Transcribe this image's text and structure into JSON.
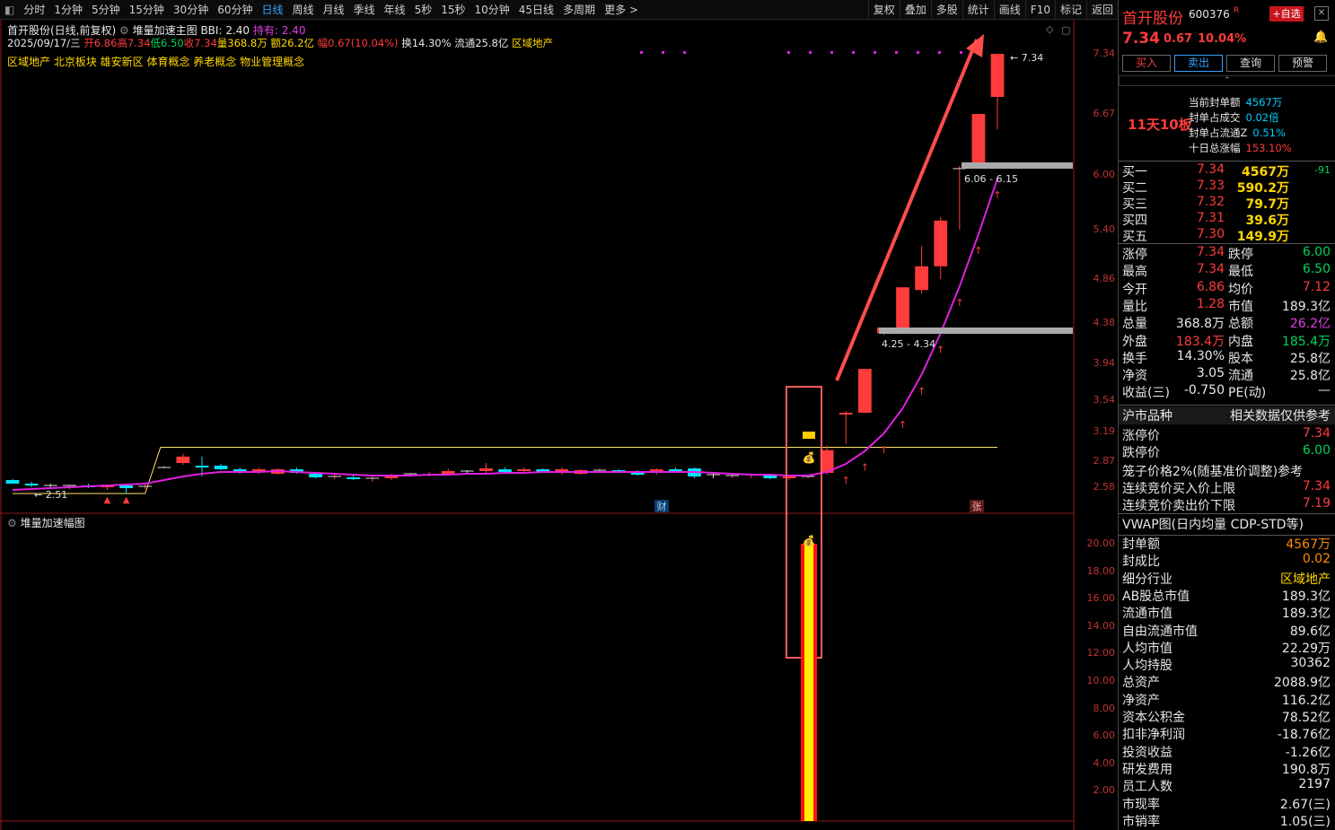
{
  "tabs": [
    "分时",
    "1分钟",
    "5分钟",
    "15分钟",
    "30分钟",
    "60分钟",
    "日线",
    "周线",
    "月线",
    "季线",
    "年线",
    "5秒",
    "15秒",
    "10分钟",
    "45日线",
    "多周期",
    "更多 >"
  ],
  "active_tab": "日线",
  "tools": [
    "复权",
    "叠加",
    "多股",
    "统计",
    "画线",
    "F10",
    "标记",
    "返回"
  ],
  "header": {
    "name_line": "首开股份(日线,前复权)",
    "indicator_name": "堆量加速主图",
    "bbi": "BBI: 2.40",
    "hold": "持有: 2.40"
  },
  "ohlc": {
    "date": "2025/09/17/三",
    "open": "开6.86",
    "high": "高7.34",
    "low": "低6.50",
    "close": "收7.34",
    "vol": "量368.8万",
    "amt": "额26.2亿",
    "chg": "幅0.67(10.04%)",
    "turnover": "换14.30%",
    "float": "流通25.8亿",
    "sector": "区域地产"
  },
  "concepts": "区域地产 北京板块 雄安新区 体育概念 养老概念 物业管理概念",
  "price_axis": [
    "7.34",
    "6.67",
    "6.00",
    "5.40",
    "4.86",
    "4.38",
    "3.94",
    "3.54",
    "3.19",
    "2.87",
    "2.58"
  ],
  "sub_axis": [
    "20.00",
    "18.00",
    "16.00",
    "14.00",
    "12.00",
    "10.00",
    "8.00",
    "6.00",
    "4.00",
    "2.00"
  ],
  "sub_title": "堆量加速幅图",
  "annotations": {
    "high": "7.34",
    "low": "2.51",
    "zone1": "6.06 - 6.15",
    "zone2": "4.25 - 4.34",
    "cai": "财",
    "zhang": "张"
  },
  "chart_data": {
    "type": "candlestick",
    "series": [
      {
        "name": "K线",
        "ohlc": [
          [
            2.66,
            2.67,
            2.62,
            2.62
          ],
          [
            2.62,
            2.64,
            2.58,
            2.6
          ],
          [
            2.6,
            2.62,
            2.58,
            2.59
          ],
          [
            2.59,
            2.61,
            2.56,
            2.6
          ],
          [
            2.6,
            2.62,
            2.57,
            2.58
          ],
          [
            2.58,
            2.61,
            2.55,
            2.6
          ],
          [
            2.6,
            2.62,
            2.51,
            2.57
          ],
          [
            2.58,
            2.63,
            2.56,
            2.59
          ],
          [
            2.8,
            2.82,
            2.79,
            2.8
          ],
          [
            2.85,
            2.95,
            2.83,
            2.92
          ],
          [
            2.82,
            2.92,
            2.7,
            2.8
          ],
          [
            2.82,
            2.84,
            2.77,
            2.78
          ],
          [
            2.78,
            2.8,
            2.73,
            2.75
          ],
          [
            2.76,
            2.8,
            2.73,
            2.78
          ],
          [
            2.73,
            2.79,
            2.72,
            2.78
          ],
          [
            2.78,
            2.8,
            2.73,
            2.74
          ],
          [
            2.73,
            2.75,
            2.68,
            2.69
          ],
          [
            2.69,
            2.72,
            2.67,
            2.7
          ],
          [
            2.69,
            2.71,
            2.66,
            2.67
          ],
          [
            2.67,
            2.7,
            2.64,
            2.68
          ],
          [
            2.68,
            2.73,
            2.66,
            2.72
          ],
          [
            2.72,
            2.74,
            2.7,
            2.73
          ],
          [
            2.72,
            2.75,
            2.7,
            2.72
          ],
          [
            2.73,
            2.79,
            2.72,
            2.76
          ],
          [
            2.76,
            2.77,
            2.74,
            2.75
          ],
          [
            2.76,
            2.85,
            2.74,
            2.79
          ],
          [
            2.78,
            2.8,
            2.74,
            2.75
          ],
          [
            2.76,
            2.8,
            2.73,
            2.78
          ],
          [
            2.78,
            2.79,
            2.74,
            2.75
          ],
          [
            2.75,
            2.8,
            2.72,
            2.78
          ],
          [
            2.73,
            2.78,
            2.72,
            2.77
          ],
          [
            2.76,
            2.79,
            2.74,
            2.77
          ],
          [
            2.77,
            2.78,
            2.74,
            2.75
          ],
          [
            2.75,
            2.77,
            2.71,
            2.72
          ],
          [
            2.74,
            2.79,
            2.72,
            2.78
          ],
          [
            2.78,
            2.8,
            2.75,
            2.76
          ],
          [
            2.79,
            2.8,
            2.68,
            2.7
          ],
          [
            2.72,
            2.74,
            2.68,
            2.71
          ],
          [
            2.71,
            2.73,
            2.68,
            2.71
          ],
          [
            2.71,
            2.73,
            2.68,
            2.72
          ],
          [
            2.71,
            2.73,
            2.67,
            2.68
          ],
          [
            2.68,
            2.72,
            2.66,
            2.7
          ],
          [
            2.7,
            2.72,
            2.68,
            2.7
          ],
          [
            2.74,
            3.04,
            2.72,
            2.99
          ],
          [
            3.38,
            3.42,
            3.06,
            3.4
          ],
          [
            3.4,
            3.88,
            3.4,
            3.88
          ],
          [
            4.27,
            4.33,
            4.25,
            4.33
          ],
          [
            4.33,
            4.77,
            4.3,
            4.77
          ],
          [
            4.74,
            5.22,
            4.7,
            5.0
          ],
          [
            5.0,
            5.54,
            4.86,
            5.5
          ],
          [
            6.06,
            6.1,
            5.4,
            6.07
          ],
          [
            6.1,
            6.67,
            6.1,
            6.67
          ],
          [
            6.86,
            7.34,
            6.5,
            7.34
          ]
        ]
      }
    ],
    "vwap_line": [
      2.55,
      2.56,
      2.57,
      2.58,
      2.59,
      2.6,
      2.61,
      2.62,
      2.66,
      2.7,
      2.73,
      2.75,
      2.75,
      2.75,
      2.76,
      2.75,
      2.74,
      2.73,
      2.72,
      2.71,
      2.71,
      2.71,
      2.72,
      2.72,
      2.73,
      2.73,
      2.74,
      2.74,
      2.75,
      2.75,
      2.75,
      2.75,
      2.75,
      2.75,
      2.75,
      2.75,
      2.75,
      2.74,
      2.73,
      2.72,
      2.72,
      2.71,
      2.71,
      2.75,
      2.84,
      2.98,
      3.17,
      3.45,
      3.82,
      4.27,
      4.78,
      5.35,
      5.96
    ],
    "resistance": 3.02,
    "support": 2.51,
    "sub_values": [
      20.0
    ]
  },
  "right": {
    "name": "首开股份",
    "code": "600376",
    "r": "R",
    "fav": "+自选",
    "price": "7.34",
    "change": "0.67",
    "pct": "10.04%",
    "buttons": [
      "买入",
      "卖出",
      "查询",
      "预警"
    ],
    "limit_text": "11天10板",
    "seal": [
      {
        "k": "当前封单额",
        "v": "4567万"
      },
      {
        "k": "封单占成交",
        "v": "0.02倍"
      },
      {
        "k": "封单占流通Z",
        "v": "0.51%"
      },
      {
        "k": "十日总涨幅",
        "v": "153.10%"
      }
    ],
    "bids": [
      {
        "k": "买一",
        "p": "7.34",
        "q": "4567万",
        "x": "-91"
      },
      {
        "k": "买二",
        "p": "7.33",
        "q": "590.2万",
        "x": ""
      },
      {
        "k": "买三",
        "p": "7.32",
        "q": "79.7万",
        "x": ""
      },
      {
        "k": "买四",
        "p": "7.31",
        "q": "39.6万",
        "x": ""
      },
      {
        "k": "买五",
        "p": "7.30",
        "q": "149.9万",
        "x": ""
      }
    ],
    "stats": [
      [
        "涨停",
        "7.34",
        "跌停",
        "6.00"
      ],
      [
        "最高",
        "7.34",
        "最低",
        "6.50"
      ],
      [
        "今开",
        "6.86",
        "均价",
        "7.12"
      ],
      [
        "量比",
        "1.28",
        "市值",
        "189.3亿"
      ],
      [
        "总量",
        "368.8万",
        "总额",
        "26.2亿"
      ],
      [
        "外盘",
        "183.4万",
        "内盘",
        "185.4万"
      ],
      [
        "换手",
        "14.30%",
        "股本",
        "25.8亿"
      ],
      [
        "净资",
        "3.05",
        "流通",
        "25.8亿"
      ],
      [
        "收益(三)",
        "-0.750",
        "PE(动)",
        "—"
      ]
    ],
    "hs": {
      "a": "沪市品种",
      "b": "相关数据仅供参考"
    },
    "limits": [
      {
        "k": "涨停价",
        "v": "7.34"
      },
      {
        "k": "跌停价",
        "v": "6.00"
      }
    ],
    "cage": "笼子价格2%(随基准价调整)参考",
    "auction": [
      {
        "k": "连续竞价买入价上限",
        "v": "7.34"
      },
      {
        "k": "连续竞价卖出价下限",
        "v": "7.19"
      }
    ],
    "vwap_title": "VWAP图(日内均量 CDP-STD等)",
    "info": [
      {
        "k": "封单额",
        "v": "4567万"
      },
      {
        "k": "封成比",
        "v": "0.02"
      },
      {
        "k": "细分行业",
        "v": "区域地产"
      },
      {
        "k": "AB股总市值",
        "v": "189.3亿"
      },
      {
        "k": "流通市值",
        "v": "189.3亿"
      },
      {
        "k": "自由流通市值",
        "v": "89.6亿"
      },
      {
        "k": "人均市值",
        "v": "22.29万"
      },
      {
        "k": "人均持股",
        "v": "30362"
      },
      {
        "k": "总资产",
        "v": "2088.9亿"
      },
      {
        "k": "净资产",
        "v": "116.2亿"
      },
      {
        "k": "资本公积金",
        "v": "78.52亿"
      },
      {
        "k": "扣非净利润",
        "v": "-18.76亿"
      },
      {
        "k": "投资收益",
        "v": "-1.26亿"
      },
      {
        "k": "研发费用",
        "v": "190.8万"
      },
      {
        "k": "员工人数",
        "v": "2197"
      },
      {
        "k": "市现率",
        "v": "2.67(三)"
      },
      {
        "k": "市销率",
        "v": "1.05(三)"
      }
    ]
  },
  "colors": {
    "up": "#ff3b3b",
    "down": "#00e0ff",
    "line": "#e020e0",
    "accent": "#35a3ff"
  }
}
